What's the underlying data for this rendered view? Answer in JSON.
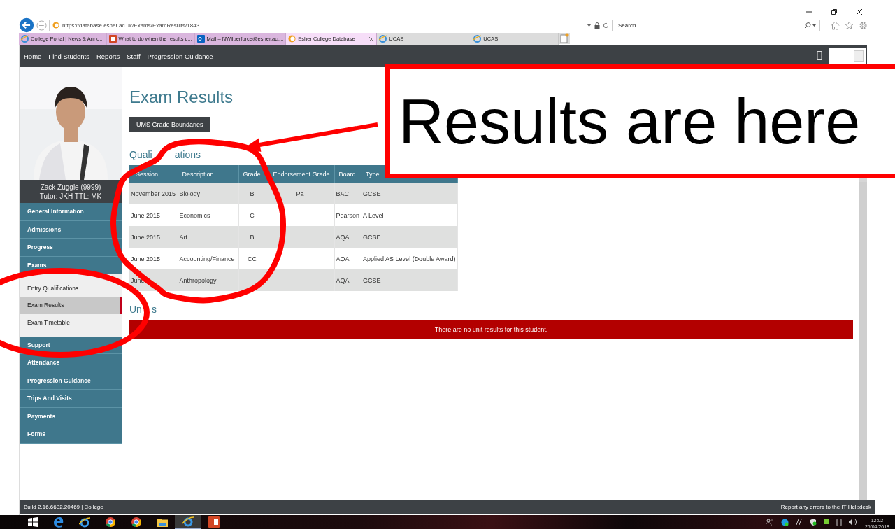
{
  "browser": {
    "url": "https://database.esher.ac.uk/Exams/ExamResults/1843",
    "search_placeholder": "Search...",
    "tabs": [
      {
        "label": "College Portal | News & Anno...",
        "selected": false
      },
      {
        "label": "What to do when the results c...",
        "selected": false
      },
      {
        "label": "Mail – NWilberforce@esher.ac....",
        "selected": false
      },
      {
        "label": "Esher College Database",
        "selected": true
      },
      {
        "label": "UCAS",
        "selected": false
      },
      {
        "label": "UCAS",
        "selected": false
      }
    ]
  },
  "nav": {
    "items": [
      "Home",
      "Find Students",
      "Reports",
      "Staff",
      "Progression Guidance"
    ]
  },
  "student": {
    "name": "Zack Zuggie (9999)",
    "tutor": "Tutor: JKH TTL: MK"
  },
  "sidebar": {
    "items": [
      {
        "label": "General Information",
        "kind": "section",
        "selected": false
      },
      {
        "label": "Admissions",
        "kind": "section",
        "selected": false
      },
      {
        "label": "Progress",
        "kind": "section",
        "selected": false
      },
      {
        "label": "Exams",
        "kind": "section",
        "selected": false
      },
      {
        "label": "Entry Qualifications",
        "kind": "sub",
        "selected": false
      },
      {
        "label": "Exam Results",
        "kind": "sub",
        "selected": true
      },
      {
        "label": "Exam Timetable",
        "kind": "sub",
        "selected": false
      },
      {
        "label": "Support",
        "kind": "section",
        "selected": false
      },
      {
        "label": "Attendance",
        "kind": "section",
        "selected": false
      },
      {
        "label": "Progression Guidance",
        "kind": "section",
        "selected": false
      },
      {
        "label": "Trips And Visits",
        "kind": "section",
        "selected": false
      },
      {
        "label": "Payments",
        "kind": "section",
        "selected": false
      },
      {
        "label": "Forms",
        "kind": "section",
        "selected": false
      }
    ]
  },
  "page": {
    "title": "Exam Results",
    "button": "UMS Grade Boundaries",
    "qualifications_heading": [
      "Quali",
      "ations"
    ],
    "table": {
      "columns": [
        "Session",
        "Description",
        "Grade",
        "Endorsement Grade",
        "Board",
        "Type"
      ],
      "rows": [
        {
          "session": "November 2015",
          "description": "Biology",
          "grade": "B",
          "endorsement": "Pa",
          "board": "BAC",
          "type": "GCSE"
        },
        {
          "session": "June 2015",
          "description": "Economics",
          "grade": "C",
          "board": "Pearson",
          "type": "A Level"
        },
        {
          "session": "June 2015",
          "description": "Art",
          "grade": "B",
          "board": "AQA",
          "type": "GCSE"
        },
        {
          "session": "June 2015",
          "description": "Accounting/Finance",
          "grade": "CC",
          "board": "AQA",
          "type": "Applied AS Level (Double Award)"
        },
        {
          "session": "June",
          "description": "Anthropology",
          "board": "AQA",
          "type": "GCSE"
        }
      ]
    },
    "units_heading": [
      "Un",
      "s"
    ],
    "units_alert": "There are no unit results for this student."
  },
  "footer": {
    "build": "Build 2.16.6682.20469 | College",
    "report": "Report any errors to the IT Helpdesk"
  },
  "taskbar": {
    "apps": [
      {
        "selected": false
      },
      {
        "selected": false
      },
      {
        "selected": false
      },
      {
        "selected": false
      },
      {
        "selected": false
      },
      {
        "selected": false
      },
      {
        "selected": true
      },
      {
        "selected": false
      }
    ],
    "time": "12:02",
    "date": "25/04/2018"
  },
  "annotation": {
    "callout": "Results are here"
  }
}
